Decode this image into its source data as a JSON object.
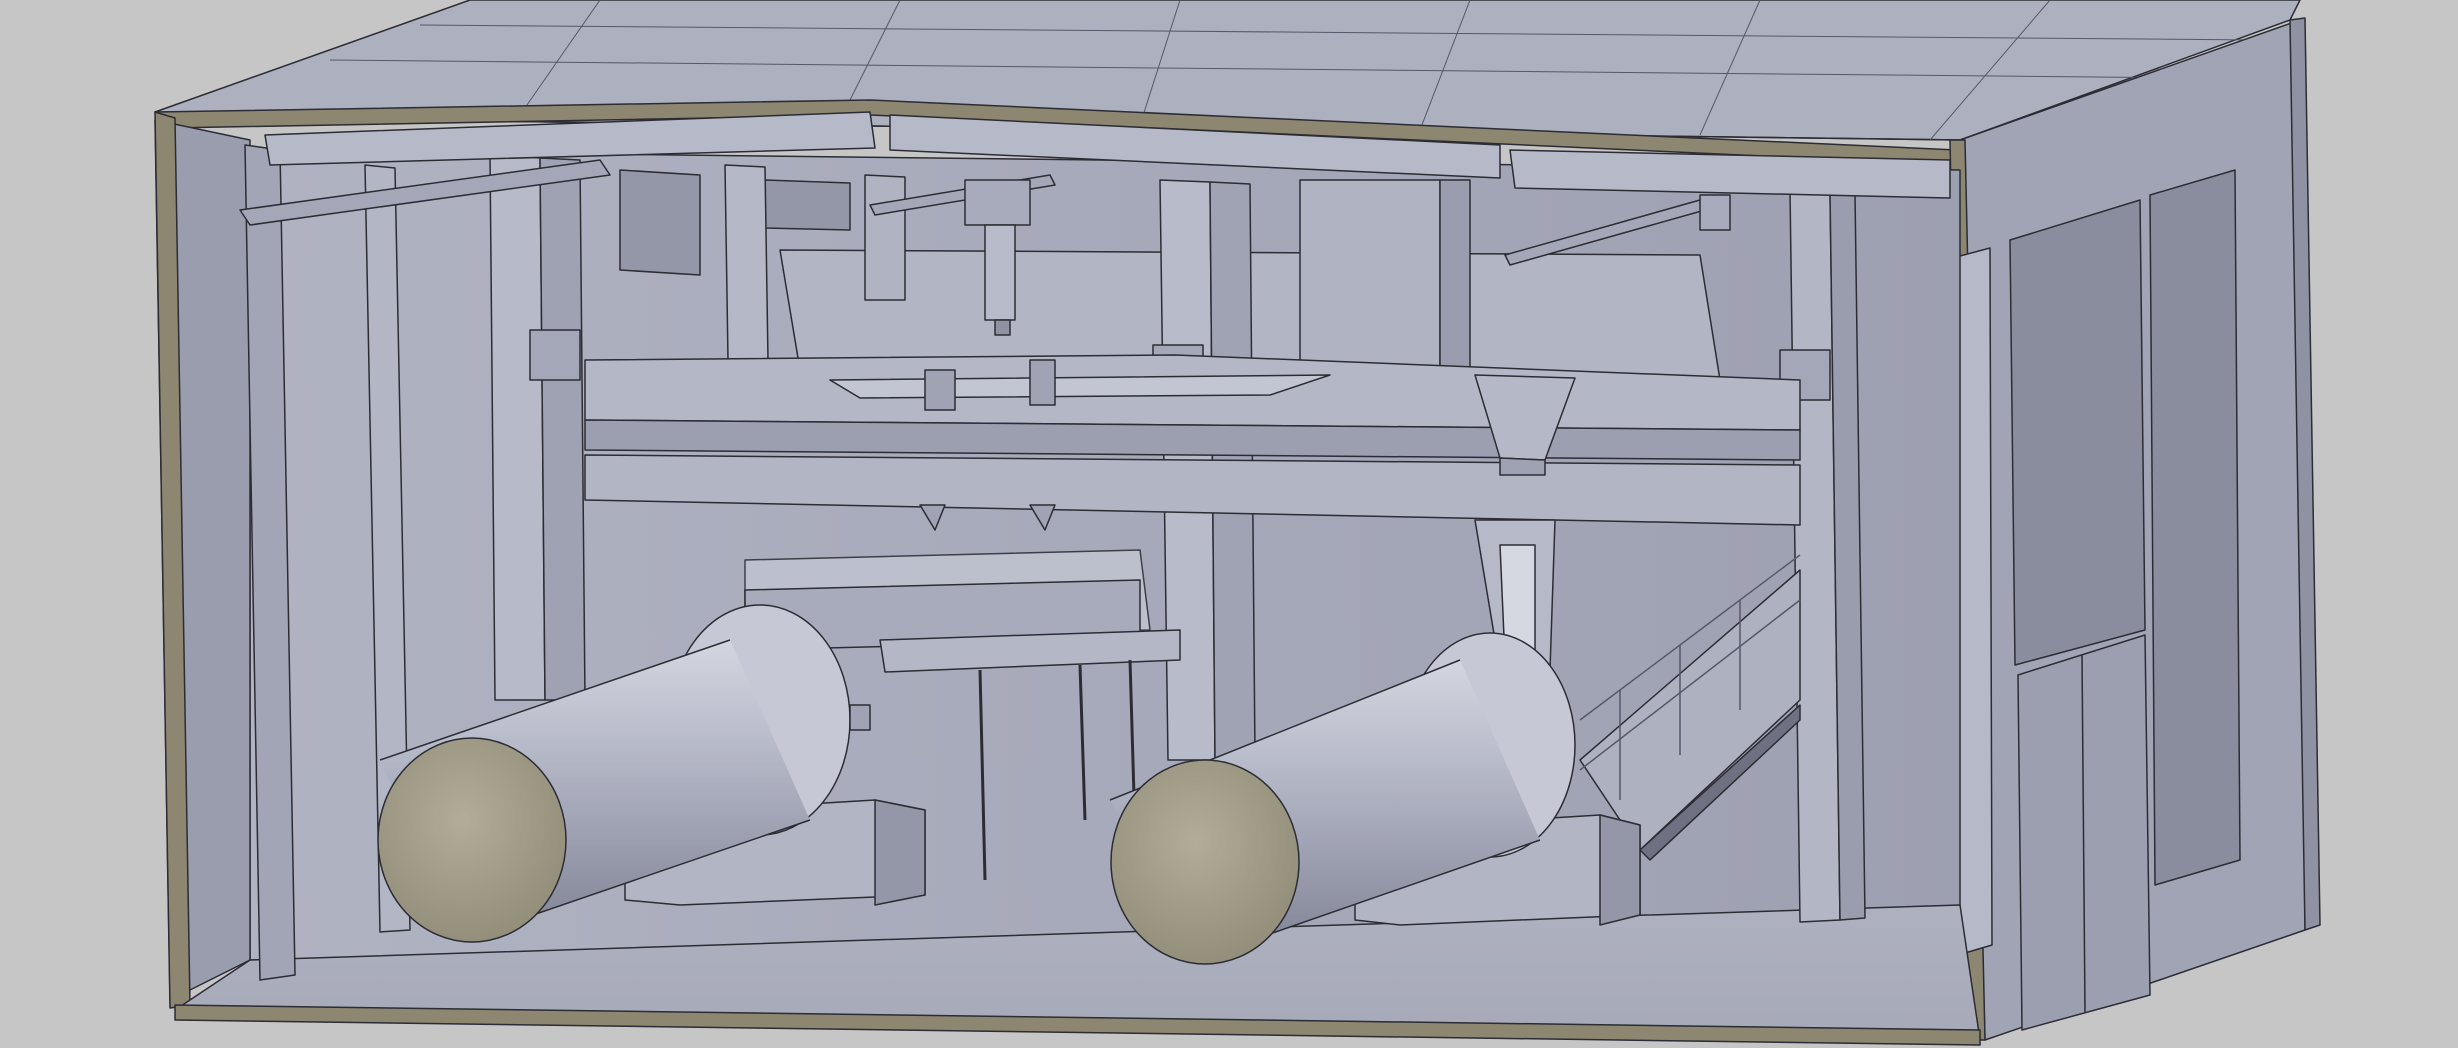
{
  "viewport": {
    "background_color": "#c6c6c6"
  },
  "colors": {
    "surface_light": "#b9bccb",
    "surface_mid": "#a5a8b9",
    "surface_dark": "#8f92a3",
    "section_cut": "#8d8671",
    "cylinder_end": "#9c9886",
    "edge_line": "#2b2c34"
  },
  "model": {
    "subject": "industrial-hall-section-view",
    "components": [
      "roof",
      "back-wall",
      "left-wall",
      "right-wall-with-windows",
      "steel-columns",
      "mezzanine-platform",
      "feed-hopper",
      "rotary-drum-left",
      "rotary-drum-right",
      "drum-supports",
      "conveyor-ramp",
      "handrail",
      "double-door"
    ]
  }
}
